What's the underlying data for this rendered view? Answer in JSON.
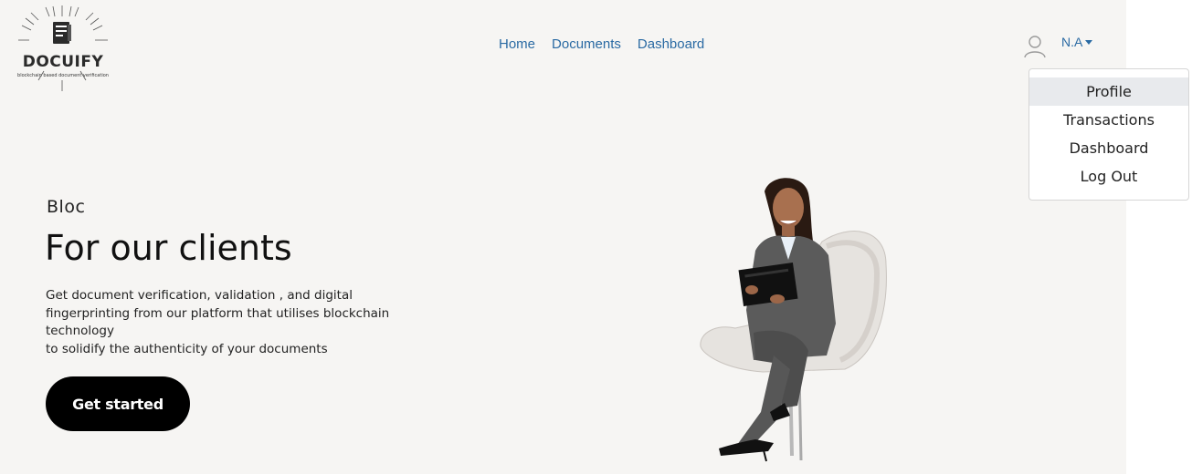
{
  "brand": {
    "name": "DOCUIFY",
    "tagline": "blockchain based document verification"
  },
  "nav": {
    "items": [
      {
        "label": "Home"
      },
      {
        "label": "Documents"
      },
      {
        "label": "Dashboard"
      }
    ]
  },
  "user": {
    "name": "N.A",
    "menu": [
      {
        "label": "Profile",
        "active": true
      },
      {
        "label": "Transactions"
      },
      {
        "label": "Dashboard"
      },
      {
        "label": "Log Out"
      }
    ]
  },
  "hero": {
    "kicker": "Bloc",
    "title": "For our clients",
    "description": [
      "Get document verification, validation , and digital",
      "fingerprinting from our platform that utilises blockchain",
      "technology",
      "to solidify the authenticity of your documents"
    ],
    "cta_label": "Get started"
  },
  "colors": {
    "background": "#f6f5f3",
    "link": "#2a6aa3",
    "cta_bg": "#000000",
    "menu_active": "#e8eaed"
  },
  "icons": {
    "user": "user-avatar-icon",
    "caret": "caret-down-icon",
    "logo": "document-logo-icon"
  }
}
